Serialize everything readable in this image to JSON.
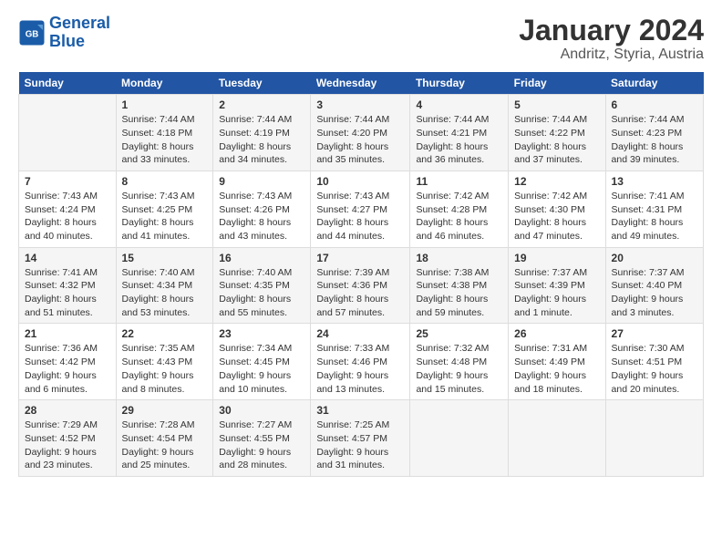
{
  "header": {
    "logo_line1": "General",
    "logo_line2": "Blue",
    "title": "January 2024",
    "subtitle": "Andritz, Styria, Austria"
  },
  "columns": [
    "Sunday",
    "Monday",
    "Tuesday",
    "Wednesday",
    "Thursday",
    "Friday",
    "Saturday"
  ],
  "weeks": [
    [
      {
        "day": "",
        "info": ""
      },
      {
        "day": "1",
        "info": "Sunrise: 7:44 AM\nSunset: 4:18 PM\nDaylight: 8 hours\nand 33 minutes."
      },
      {
        "day": "2",
        "info": "Sunrise: 7:44 AM\nSunset: 4:19 PM\nDaylight: 8 hours\nand 34 minutes."
      },
      {
        "day": "3",
        "info": "Sunrise: 7:44 AM\nSunset: 4:20 PM\nDaylight: 8 hours\nand 35 minutes."
      },
      {
        "day": "4",
        "info": "Sunrise: 7:44 AM\nSunset: 4:21 PM\nDaylight: 8 hours\nand 36 minutes."
      },
      {
        "day": "5",
        "info": "Sunrise: 7:44 AM\nSunset: 4:22 PM\nDaylight: 8 hours\nand 37 minutes."
      },
      {
        "day": "6",
        "info": "Sunrise: 7:44 AM\nSunset: 4:23 PM\nDaylight: 8 hours\nand 39 minutes."
      }
    ],
    [
      {
        "day": "7",
        "info": "Sunrise: 7:43 AM\nSunset: 4:24 PM\nDaylight: 8 hours\nand 40 minutes."
      },
      {
        "day": "8",
        "info": "Sunrise: 7:43 AM\nSunset: 4:25 PM\nDaylight: 8 hours\nand 41 minutes."
      },
      {
        "day": "9",
        "info": "Sunrise: 7:43 AM\nSunset: 4:26 PM\nDaylight: 8 hours\nand 43 minutes."
      },
      {
        "day": "10",
        "info": "Sunrise: 7:43 AM\nSunset: 4:27 PM\nDaylight: 8 hours\nand 44 minutes."
      },
      {
        "day": "11",
        "info": "Sunrise: 7:42 AM\nSunset: 4:28 PM\nDaylight: 8 hours\nand 46 minutes."
      },
      {
        "day": "12",
        "info": "Sunrise: 7:42 AM\nSunset: 4:30 PM\nDaylight: 8 hours\nand 47 minutes."
      },
      {
        "day": "13",
        "info": "Sunrise: 7:41 AM\nSunset: 4:31 PM\nDaylight: 8 hours\nand 49 minutes."
      }
    ],
    [
      {
        "day": "14",
        "info": "Sunrise: 7:41 AM\nSunset: 4:32 PM\nDaylight: 8 hours\nand 51 minutes."
      },
      {
        "day": "15",
        "info": "Sunrise: 7:40 AM\nSunset: 4:34 PM\nDaylight: 8 hours\nand 53 minutes."
      },
      {
        "day": "16",
        "info": "Sunrise: 7:40 AM\nSunset: 4:35 PM\nDaylight: 8 hours\nand 55 minutes."
      },
      {
        "day": "17",
        "info": "Sunrise: 7:39 AM\nSunset: 4:36 PM\nDaylight: 8 hours\nand 57 minutes."
      },
      {
        "day": "18",
        "info": "Sunrise: 7:38 AM\nSunset: 4:38 PM\nDaylight: 8 hours\nand 59 minutes."
      },
      {
        "day": "19",
        "info": "Sunrise: 7:37 AM\nSunset: 4:39 PM\nDaylight: 9 hours\nand 1 minute."
      },
      {
        "day": "20",
        "info": "Sunrise: 7:37 AM\nSunset: 4:40 PM\nDaylight: 9 hours\nand 3 minutes."
      }
    ],
    [
      {
        "day": "21",
        "info": "Sunrise: 7:36 AM\nSunset: 4:42 PM\nDaylight: 9 hours\nand 6 minutes."
      },
      {
        "day": "22",
        "info": "Sunrise: 7:35 AM\nSunset: 4:43 PM\nDaylight: 9 hours\nand 8 minutes."
      },
      {
        "day": "23",
        "info": "Sunrise: 7:34 AM\nSunset: 4:45 PM\nDaylight: 9 hours\nand 10 minutes."
      },
      {
        "day": "24",
        "info": "Sunrise: 7:33 AM\nSunset: 4:46 PM\nDaylight: 9 hours\nand 13 minutes."
      },
      {
        "day": "25",
        "info": "Sunrise: 7:32 AM\nSunset: 4:48 PM\nDaylight: 9 hours\nand 15 minutes."
      },
      {
        "day": "26",
        "info": "Sunrise: 7:31 AM\nSunset: 4:49 PM\nDaylight: 9 hours\nand 18 minutes."
      },
      {
        "day": "27",
        "info": "Sunrise: 7:30 AM\nSunset: 4:51 PM\nDaylight: 9 hours\nand 20 minutes."
      }
    ],
    [
      {
        "day": "28",
        "info": "Sunrise: 7:29 AM\nSunset: 4:52 PM\nDaylight: 9 hours\nand 23 minutes."
      },
      {
        "day": "29",
        "info": "Sunrise: 7:28 AM\nSunset: 4:54 PM\nDaylight: 9 hours\nand 25 minutes."
      },
      {
        "day": "30",
        "info": "Sunrise: 7:27 AM\nSunset: 4:55 PM\nDaylight: 9 hours\nand 28 minutes."
      },
      {
        "day": "31",
        "info": "Sunrise: 7:25 AM\nSunset: 4:57 PM\nDaylight: 9 hours\nand 31 minutes."
      },
      {
        "day": "",
        "info": ""
      },
      {
        "day": "",
        "info": ""
      },
      {
        "day": "",
        "info": ""
      }
    ]
  ]
}
